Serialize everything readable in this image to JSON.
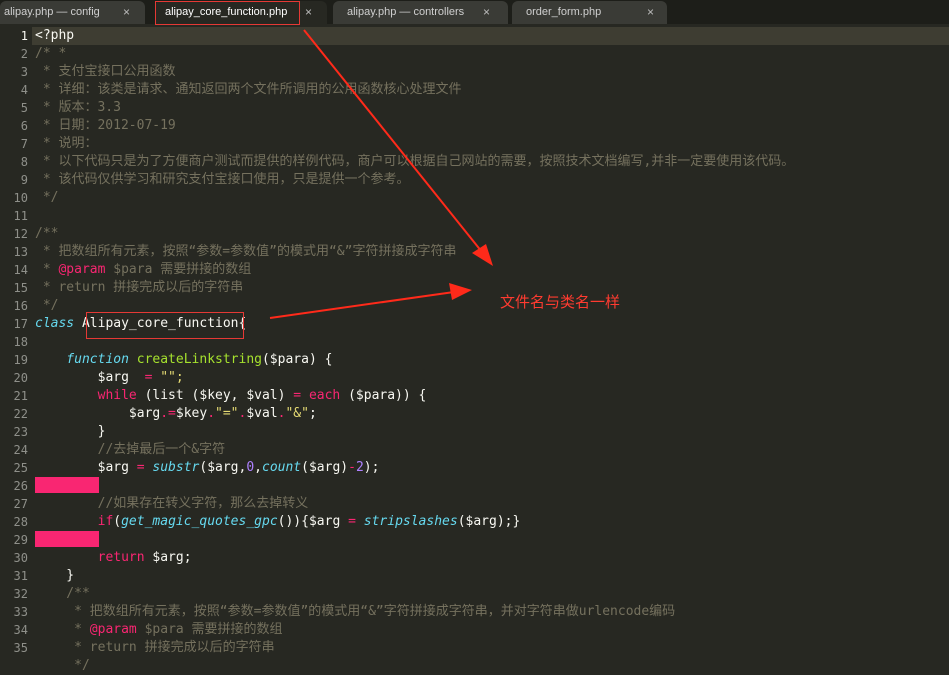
{
  "tabs": [
    {
      "label": "alipay.php — config",
      "close": "×",
      "active": false
    },
    {
      "label": "alipay_core_function.php",
      "close": "×",
      "active": true
    },
    {
      "label": "alipay.php — controllers",
      "close": "×",
      "active": false
    },
    {
      "label": "order_form.php",
      "close": "×",
      "active": false
    }
  ],
  "gutter": [
    "1",
    "2",
    "3",
    "4",
    "5",
    "6",
    "7",
    "8",
    "9",
    "10",
    "11",
    "12",
    "13",
    "14",
    "15",
    "16",
    "17",
    "18",
    "19",
    "20",
    "21",
    "22",
    "23",
    "24",
    "25",
    "26",
    "27",
    "28",
    "29",
    "30",
    "31",
    "32",
    "33",
    "34",
    "35"
  ],
  "code": {
    "l1": "<?php",
    "l2": "/* *",
    "l3": " * 支付宝接口公用函数",
    "l4": " * 详细：该类是请求、通知返回两个文件所调用的公用函数核心处理文件",
    "l5": " * 版本：3.3",
    "l6": " * 日期：2012-07-19",
    "l7": " * 说明：",
    "l8": " * 以下代码只是为了方便商户测试而提供的样例代码，商户可以根据自己网站的需要，按照技术文档编写,并非一定要使用该代码。",
    "l9": " * 该代码仅供学习和研究支付宝接口使用，只是提供一个参考。",
    "l10": " */",
    "l12": "/**",
    "l13": " * 把数组所有元素，按照“参数=参数值”的模式用“&”字符拼接成字符串",
    "l14a": " * ",
    "l14b": "@param",
    "l14c": " $para 需要拼接的数组",
    "l15": " * return 拼接完成以后的字符串",
    "l16": " */",
    "l17a": "class",
    "l17b": " Alipay_core_function{",
    "l19a": "    function",
    "l19b": " createLinkstring",
    "l19c": "($para) {",
    "l20a": "        $arg  ",
    "l20b": "=",
    "l20c": " \"\";",
    "l21a": "        while",
    "l21b": " (list ($key, $val) ",
    "l21c": "=",
    "l21d": " each",
    "l21e": " ($para)) {",
    "l22a": "            $arg",
    "l22b": ".=",
    "l22c": "$key",
    "l22d": ".",
    "l22e": "\"=\"",
    "l22f": ".",
    "l22g": "$val",
    "l22h": ".",
    "l22i": "\"&\"",
    "l22j": ";",
    "l23": "        }",
    "l24": "        //去掉最后一个&字符",
    "l25a": "        $arg ",
    "l25b": "=",
    "l25c": " substr",
    "l25d": "($arg,",
    "l25e": "0",
    "l25f": ",",
    "l25g": "count",
    "l25h": "($arg)",
    "l25i": "-",
    "l25j": "2",
    "l25k": ");",
    "l27": "        //如果存在转义字符，那么去掉转义",
    "l28a": "        if",
    "l28b": "(",
    "l28c": "get_magic_quotes_gpc",
    "l28d": "()){$arg ",
    "l28e": "=",
    "l28f": " stripslashes",
    "l28g": "($arg);}",
    "l30a": "        return",
    "l30b": " $arg;",
    "l31": "    }",
    "l32": "    /**",
    "l33": "     * 把数组所有元素，按照“参数=参数值”的模式用“&”字符拼接成字符串，并对字符串做urlencode编码",
    "l34a": "     * ",
    "l34b": "@param",
    "l34c": " $para 需要拼接的数组",
    "l35": "     * return 拼接完成以后的字符串",
    "l36": "     */"
  },
  "annotation": {
    "note": "文件名与类名一样"
  },
  "colors": {
    "background": "#272822",
    "comment": "#75715e",
    "keyword": "#66d9ef",
    "operator": "#f92672",
    "function": "#a6e22e",
    "string": "#e6db74",
    "number": "#ae81ff",
    "annotation_red": "#ff3b30"
  }
}
